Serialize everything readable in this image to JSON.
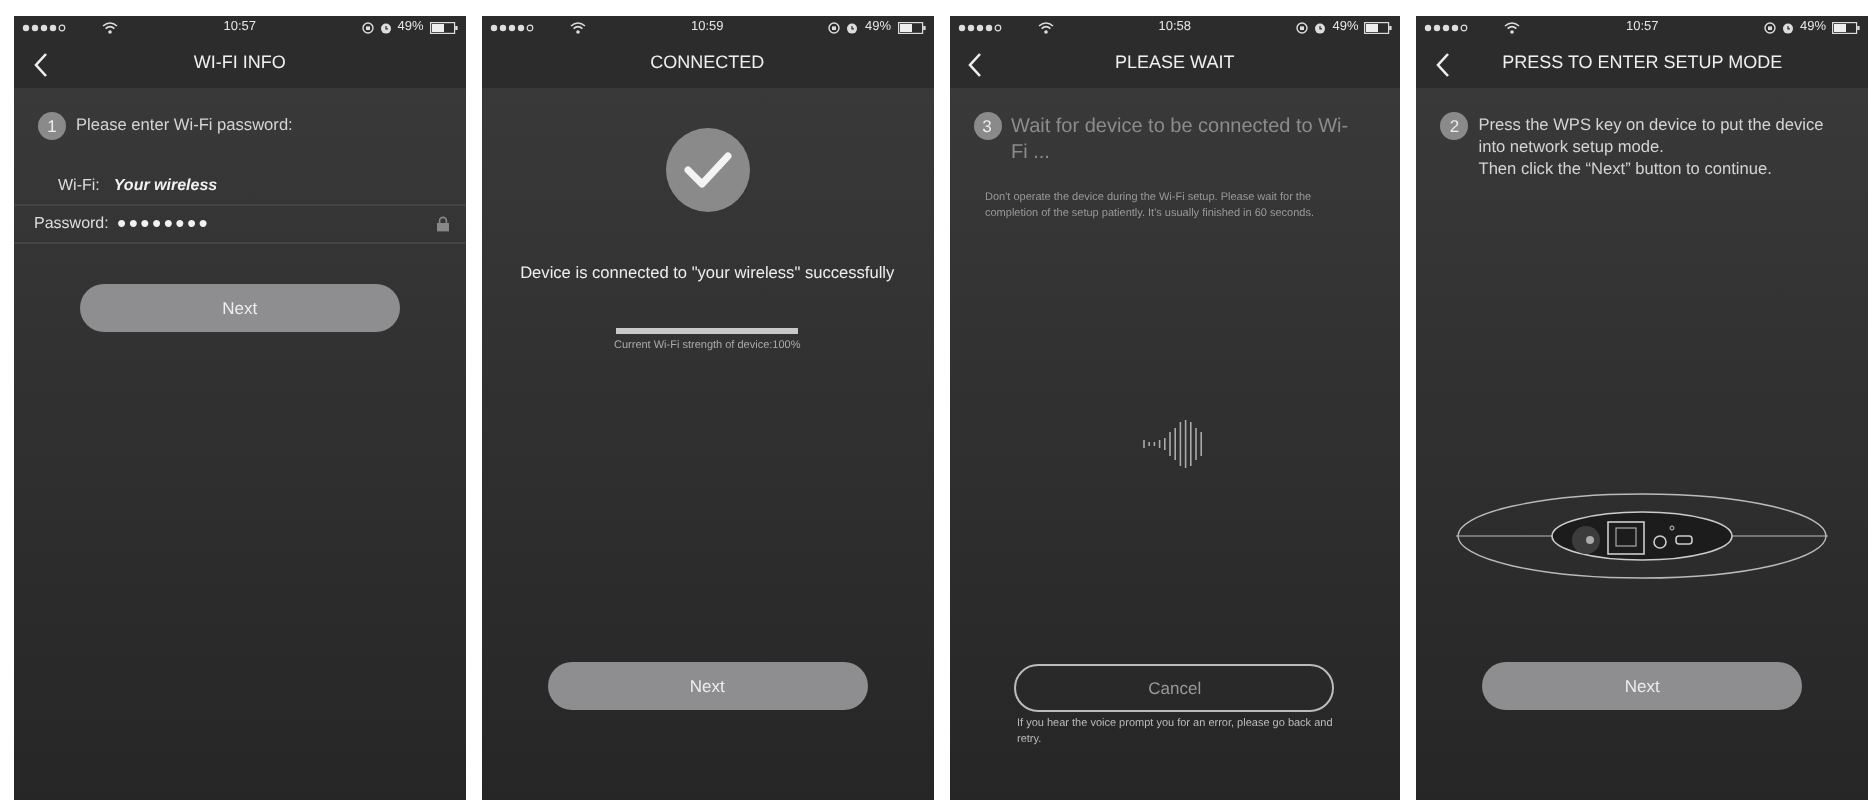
{
  "screens": [
    {
      "kind": "wifi_info",
      "status_bar": {
        "time": "10:57",
        "battery": "49%"
      },
      "header": {
        "title": "WI-FI INFO",
        "back": true
      },
      "step": {
        "number": "1",
        "lines": [
          "Please enter Wi-Fi password:"
        ],
        "dimmed": false
      },
      "fields": [
        {
          "label": "Wi-Fi:",
          "value": "Your wireless",
          "locked": false
        },
        {
          "label": "Password:",
          "value": "●●●●●●●●",
          "locked": true
        }
      ],
      "button": {
        "label": "Next",
        "outlined": false
      }
    },
    {
      "kind": "connected",
      "status_bar": {
        "time": "10:59",
        "battery": "49%"
      },
      "header": {
        "title": "CONNECTED",
        "back": false
      },
      "message": "Device is connected to \"your wireless\" successfully",
      "strength": {
        "level": 1,
        "caption": "Current Wi-Fi strength of device:100%"
      },
      "button": {
        "label": "Next",
        "outlined": false
      }
    },
    {
      "kind": "please_wait",
      "status_bar": {
        "time": "10:58",
        "battery": "49%"
      },
      "header": {
        "title": "PLEASE WAIT",
        "back": true
      },
      "step": {
        "number": "3",
        "lines": [
          "Wait for device to be connected to Wi-Fi ..."
        ],
        "dimmed": true
      },
      "note": "Don't operate the device during the Wi-Fi setup. Please wait for the completion of the setup patiently. It's usually finished in 60 seconds.",
      "button": {
        "label": "Cancel",
        "outlined": true
      },
      "footer_note": "If you hear the voice prompt you for an error, please go back and retry."
    },
    {
      "kind": "setup_mode",
      "status_bar": {
        "time": "10:57",
        "battery": "49%"
      },
      "header": {
        "title": "PRESS TO ENTER SETUP MODE",
        "back": true
      },
      "step": {
        "number": "2",
        "lines": [
          "Press the WPS key on device to put the device into network setup mode.",
          "Then click the “Next” button to continue."
        ],
        "dimmed": false
      },
      "button": {
        "label": "Next",
        "outlined": false
      }
    }
  ]
}
